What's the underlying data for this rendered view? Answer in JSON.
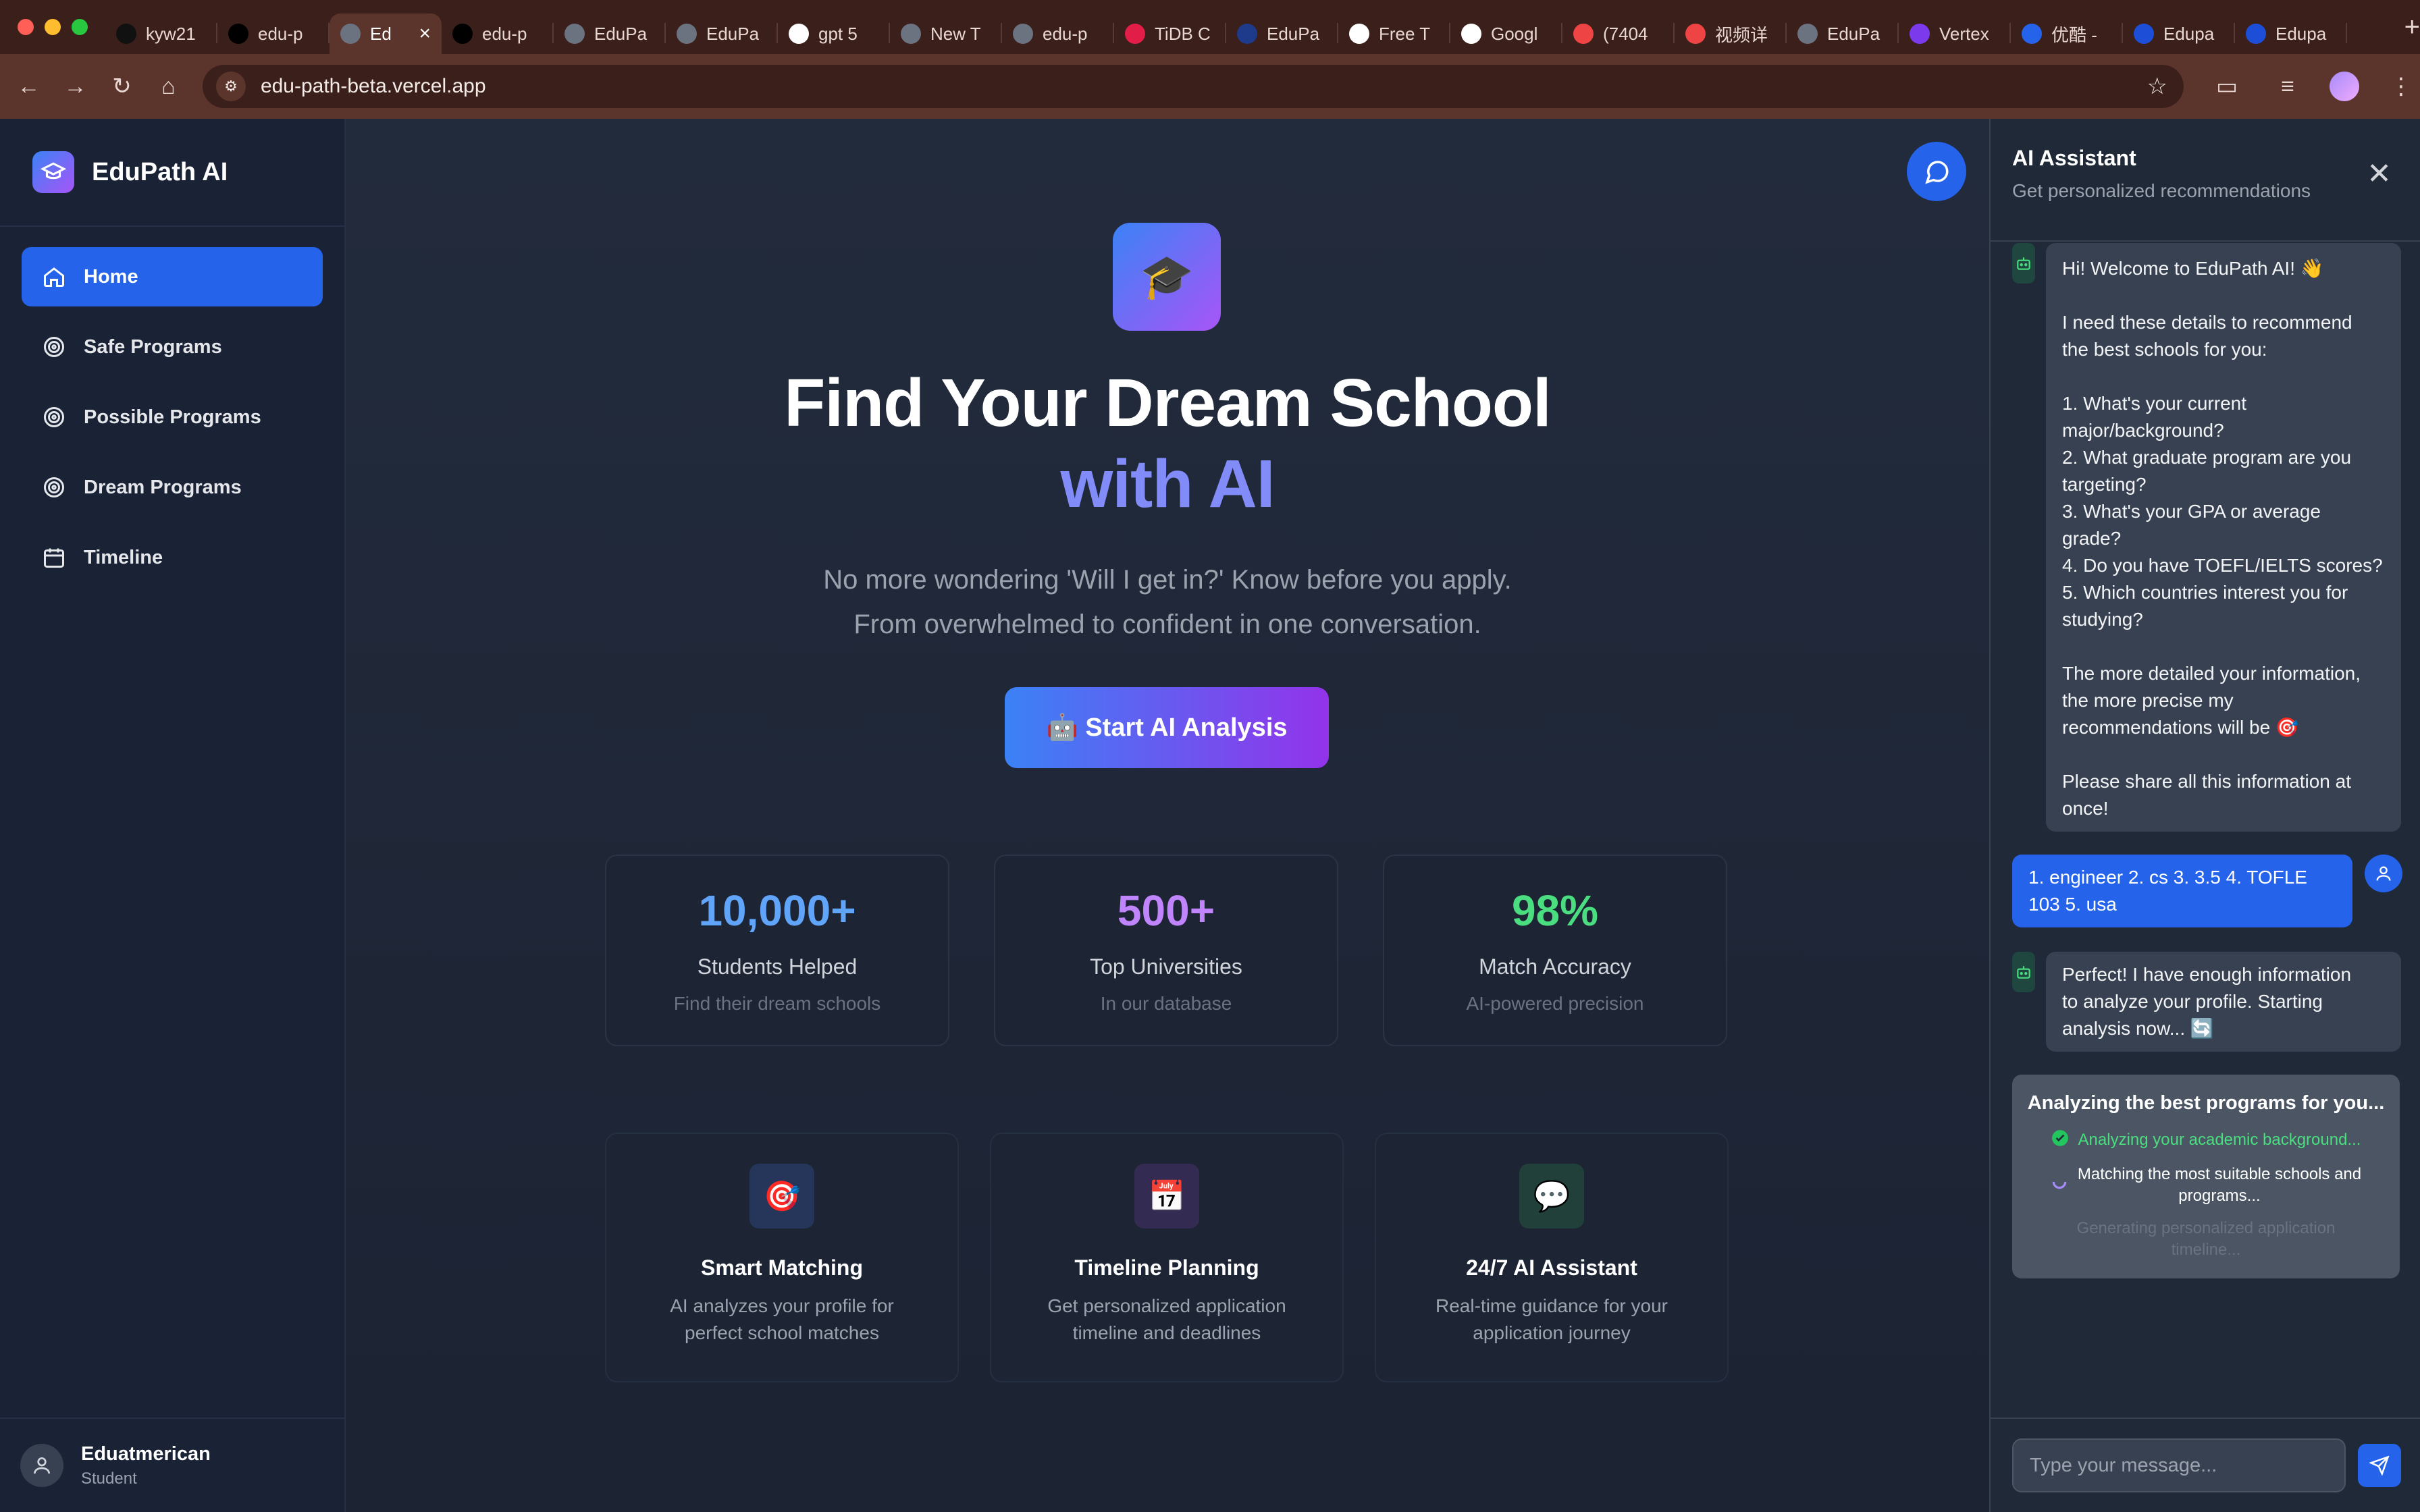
{
  "browser": {
    "tabs": [
      {
        "label": "kyw21",
        "icon": "github-icon",
        "color": "#111111"
      },
      {
        "label": "edu-p",
        "icon": "vercel-icon",
        "color": "#000000"
      },
      {
        "label": "Ed",
        "icon": "globe-icon",
        "color": "#6b7280",
        "active": true
      },
      {
        "label": "edu-p",
        "icon": "vercel-icon",
        "color": "#000000"
      },
      {
        "label": "EduPa",
        "icon": "globe-icon",
        "color": "#6b7280"
      },
      {
        "label": "EduPa",
        "icon": "globe-icon",
        "color": "#6b7280"
      },
      {
        "label": "gpt 5",
        "icon": "google-icon",
        "color": "#ffffff"
      },
      {
        "label": "New T",
        "icon": "chrome-icon",
        "color": "#6b7280"
      },
      {
        "label": "edu-p",
        "icon": "globe-icon",
        "color": "#6b7280"
      },
      {
        "label": "TiDB C",
        "icon": "tidb-icon",
        "color": "#e11d48"
      },
      {
        "label": "EduPa",
        "icon": "d-icon",
        "color": "#1e3a8a"
      },
      {
        "label": "Free T",
        "icon": "pause-icon",
        "color": "#ffffff"
      },
      {
        "label": "Googl",
        "icon": "google-icon",
        "color": "#ffffff"
      },
      {
        "label": "(7404",
        "icon": "youtube-icon",
        "color": "#ef4444"
      },
      {
        "label": "视频详",
        "icon": "youtube-icon",
        "color": "#ef4444"
      },
      {
        "label": "EduPa",
        "icon": "globe-icon",
        "color": "#6b7280"
      },
      {
        "label": "Vertex",
        "icon": "vertex-icon",
        "color": "#7c3aed"
      },
      {
        "label": "优酷 -",
        "icon": "youku-icon",
        "color": "#2563eb"
      },
      {
        "label": "Edupa",
        "icon": "v-icon",
        "color": "#1d4ed8"
      },
      {
        "label": "Edupa",
        "icon": "v-icon",
        "color": "#1d4ed8"
      }
    ],
    "url": "edu-path-beta.vercel.app"
  },
  "sidebar": {
    "brand": "EduPath AI",
    "items": [
      {
        "label": "Home",
        "icon": "home-icon",
        "active": true
      },
      {
        "label": "Safe Programs",
        "icon": "target-icon"
      },
      {
        "label": "Possible Programs",
        "icon": "target-icon"
      },
      {
        "label": "Dream Programs",
        "icon": "target-icon"
      },
      {
        "label": "Timeline",
        "icon": "calendar-icon"
      }
    ],
    "user": {
      "name": "Eduatmerican",
      "role": "Student"
    }
  },
  "hero": {
    "title_line1": "Find Your Dream School",
    "title_line2": "with AI",
    "subtitle_line1": "No more wondering 'Will I get in?' Know before you apply.",
    "subtitle_line2": "From overwhelmed to confident in one conversation.",
    "cta": "🤖 Start AI Analysis"
  },
  "stats": [
    {
      "value": "10,000+",
      "label": "Students Helped",
      "desc": "Find their dream schools",
      "color": "#60a5fa"
    },
    {
      "value": "500+",
      "label": "Top Universities",
      "desc": "In our database",
      "color": "#c084fc"
    },
    {
      "value": "98%",
      "label": "Match Accuracy",
      "desc": "AI-powered precision",
      "color": "#4ade80"
    }
  ],
  "features": [
    {
      "icon": "🎯",
      "title": "Smart Matching",
      "desc_line1": "AI analyzes your profile for",
      "desc_line2": "perfect school matches",
      "bg": "#26365a"
    },
    {
      "icon": "📅",
      "title": "Timeline Planning",
      "desc_line1": "Get personalized application",
      "desc_line2": "timeline and deadlines",
      "bg": "#342b52"
    },
    {
      "icon": "💬",
      "title": "24/7 AI Assistant",
      "desc_line1": "Real-time guidance for your",
      "desc_line2": "application journey",
      "bg": "#21403a"
    }
  ],
  "chat": {
    "title": "AI Assistant",
    "subtitle": "Get personalized recommendations",
    "messages": {
      "welcome": {
        "l1": "Hi! Welcome to EduPath AI! 👋",
        "l2": "I need these details to recommend",
        "l3": "the best schools for you:",
        "l4": "1. What's your current",
        "l5": "major/background?",
        "l6": "2. What graduate program are you",
        "l7": "targeting?",
        "l8": "3. What's your GPA or average",
        "l9": "grade?",
        "l10": "4. Do you have TOEFL/IELTS scores?",
        "l11": "5. Which countries interest you for",
        "l12": "studying?",
        "l13": "The more detailed your information,",
        "l14": "the more precise my",
        "l15": "recommendations will be 🎯",
        "l16": "Please share all this information at",
        "l17": "once!"
      },
      "user": {
        "l1": "1. engineer 2. cs 3. 3.5 4. TOFLE",
        "l2": "103 5. usa"
      },
      "reply": {
        "l1": "Perfect! I have enough information",
        "l2": "to analyze your profile. Starting",
        "l3": "analysis now... 🔄"
      }
    },
    "analysis": {
      "title": "Analyzing the best programs for you...",
      "step1": "Analyzing your academic background...",
      "step2_l1": "Matching the most suitable schools and",
      "step2_l2": "programs...",
      "step3_l1": "Generating personalized application",
      "step3_l2": "timeline..."
    },
    "input_placeholder": "Type your message..."
  }
}
